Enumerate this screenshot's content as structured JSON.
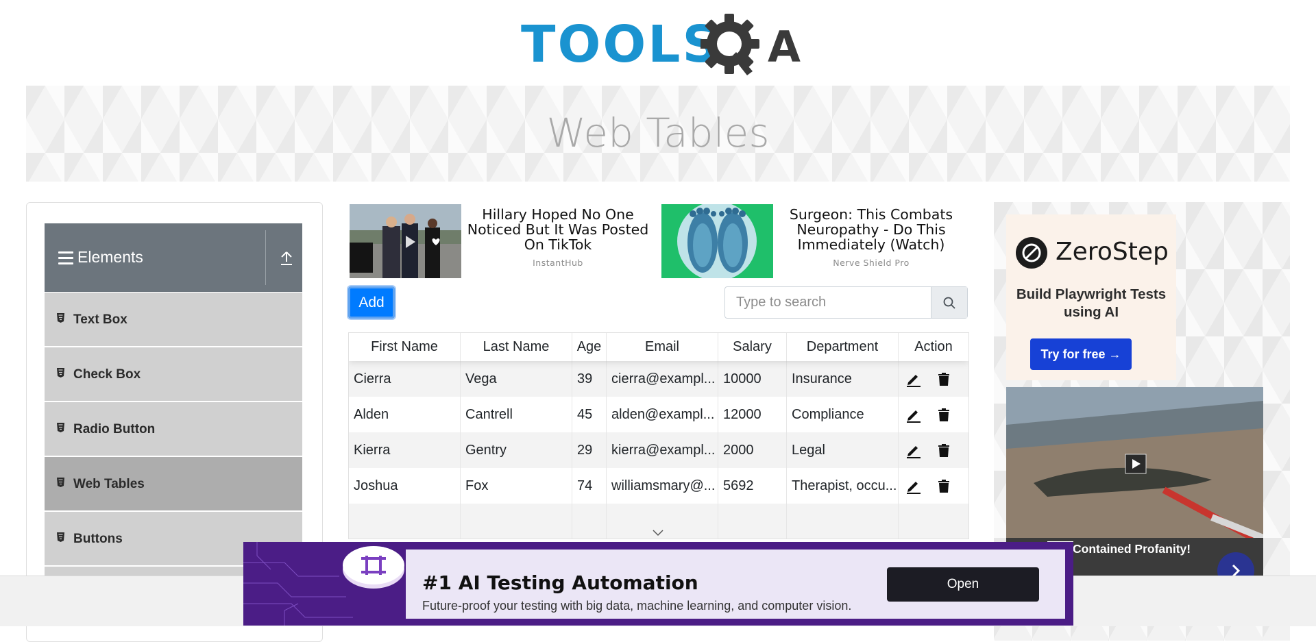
{
  "header": {
    "logo_text_tools": "TOOLS",
    "logo_text_qa": "A",
    "banner_title": "Web Tables"
  },
  "sidebar": {
    "group_title": "Elements",
    "items": [
      {
        "label": "Text Box"
      },
      {
        "label": "Check Box"
      },
      {
        "label": "Radio Button"
      },
      {
        "label": "Web Tables",
        "active": true
      },
      {
        "label": "Buttons"
      }
    ]
  },
  "ads_top": [
    {
      "headline": "Hillary Hoped No One Noticed But It Was Posted On TikTok",
      "source": "InstantHub"
    },
    {
      "headline": "Surgeon: This Combats Neuropathy - Do This Immediately (Watch)",
      "source": "Nerve Shield Pro"
    }
  ],
  "toolbar": {
    "add_label": "Add",
    "search_placeholder": "Type to search"
  },
  "table": {
    "columns": [
      "First Name",
      "Last Name",
      "Age",
      "Email",
      "Salary",
      "Department",
      "Action"
    ],
    "rows": [
      [
        "Cierra",
        "Vega",
        "39",
        "cierra@exampl...",
        "10000",
        "Insurance"
      ],
      [
        "Alden",
        "Cantrell",
        "45",
        "alden@exampl...",
        "12000",
        "Compliance"
      ],
      [
        "Kierra",
        "Gentry",
        "29",
        "kierra@exampl...",
        "2000",
        "Legal"
      ],
      [
        "Joshua",
        "Fox",
        "74",
        "williamsmary@...",
        "5692",
        "Therapist, occu..."
      ]
    ]
  },
  "right_ad": {
    "brand": "ZeroStep",
    "tagline": "Build Playwright Tests using AI",
    "cta": "Try for free →",
    "video_caption": "Contained Profanity!"
  },
  "bottom_ad": {
    "title": "#1 AI Testing Automation",
    "subtitle": "Future-proof your testing with big data, machine learning, and computer vision.",
    "button": "Open"
  },
  "colors": {
    "brand_blue": "#1a93d0",
    "primary": "#007bff",
    "sidebar_header": "#6c757d",
    "sidebar_item": "#d0d0d0",
    "sidebar_item_active": "#adadad",
    "zerostep_button": "#1741d6",
    "bottom_ad_bg": "#4b1d86"
  }
}
